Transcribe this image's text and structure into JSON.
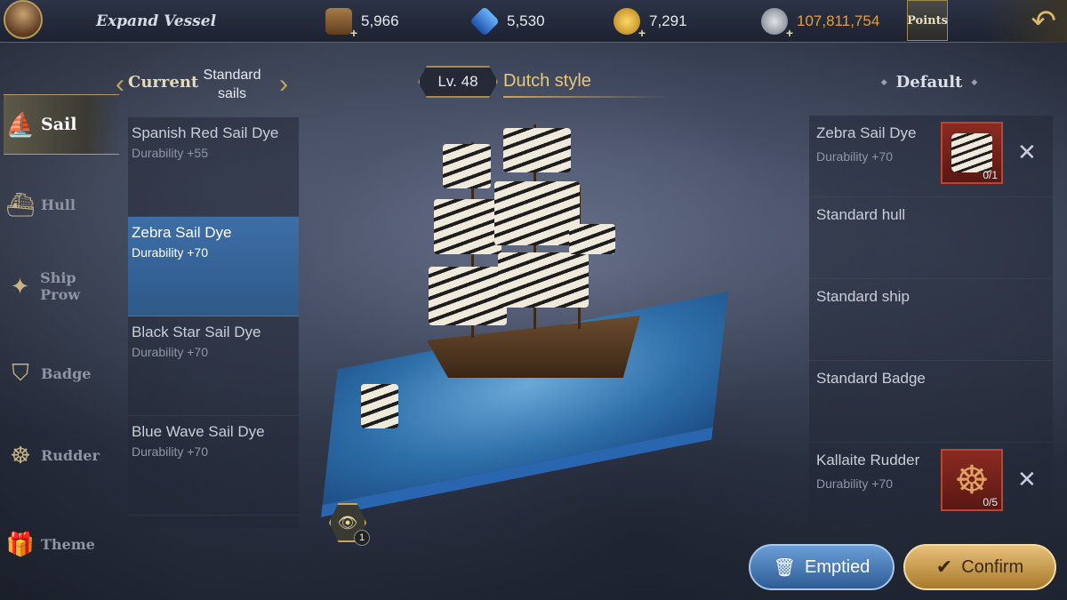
{
  "header": {
    "title": "Expand Vessel",
    "resources": [
      {
        "icon": "wood-icon",
        "value": "5,966"
      },
      {
        "icon": "gem-icon",
        "value": "5,530"
      },
      {
        "icon": "gold-coin-icon",
        "value": "7,291"
      },
      {
        "icon": "silver-coin-icon",
        "value": "107,811,754"
      }
    ],
    "points_label": "Points",
    "back_icon": "back-arrow-icon"
  },
  "tabs": [
    {
      "label": "Sail",
      "icon": "sail-icon",
      "active": true
    },
    {
      "label": "Hull",
      "icon": "hull-icon",
      "active": false
    },
    {
      "label": "Ship Prow",
      "icon": "prow-icon",
      "active": false
    },
    {
      "label": "Badge",
      "icon": "badge-icon",
      "active": false
    },
    {
      "label": "Rudder",
      "icon": "rudder-icon",
      "active": false
    },
    {
      "label": "Theme",
      "icon": "gift-icon",
      "active": false
    }
  ],
  "switcher": {
    "current_label": "Current",
    "standard_label": "Standard sails"
  },
  "dye_list": [
    {
      "name": "Spanish Red Sail Dye",
      "durability": "Durability +55",
      "selected": false
    },
    {
      "name": "Zebra Sail Dye",
      "durability": "Durability +70",
      "selected": true
    },
    {
      "name": "Black Star Sail Dye",
      "durability": "Durability +70",
      "selected": false
    },
    {
      "name": "Blue Wave Sail Dye",
      "durability": "Durability +70",
      "selected": false
    }
  ],
  "ship": {
    "level": "Lv. 48",
    "style": "Dutch style"
  },
  "preview": {
    "eye_count": "1"
  },
  "right_panel": {
    "header": "Default",
    "slots": [
      {
        "name": "Zebra Sail Dye",
        "durability": "Durability +70",
        "has_item": true,
        "item_icon": "zebra-sail-icon",
        "count": "0/1"
      },
      {
        "name": "Standard hull",
        "durability": "",
        "has_item": false
      },
      {
        "name": "Standard ship",
        "durability": "",
        "has_item": false
      },
      {
        "name": "Standard Badge",
        "durability": "",
        "has_item": false
      },
      {
        "name": "Kallaite Rudder",
        "durability": "Durability +70",
        "has_item": true,
        "item_icon": "rudder-wheel-icon",
        "count": "0/5"
      }
    ]
  },
  "buttons": {
    "emptied": "Emptied",
    "confirm": "Confirm"
  },
  "colors": {
    "accent_gold": "#c9a45e",
    "selected_blue": "#3d6ea8",
    "gold_text": "#e4a040"
  }
}
